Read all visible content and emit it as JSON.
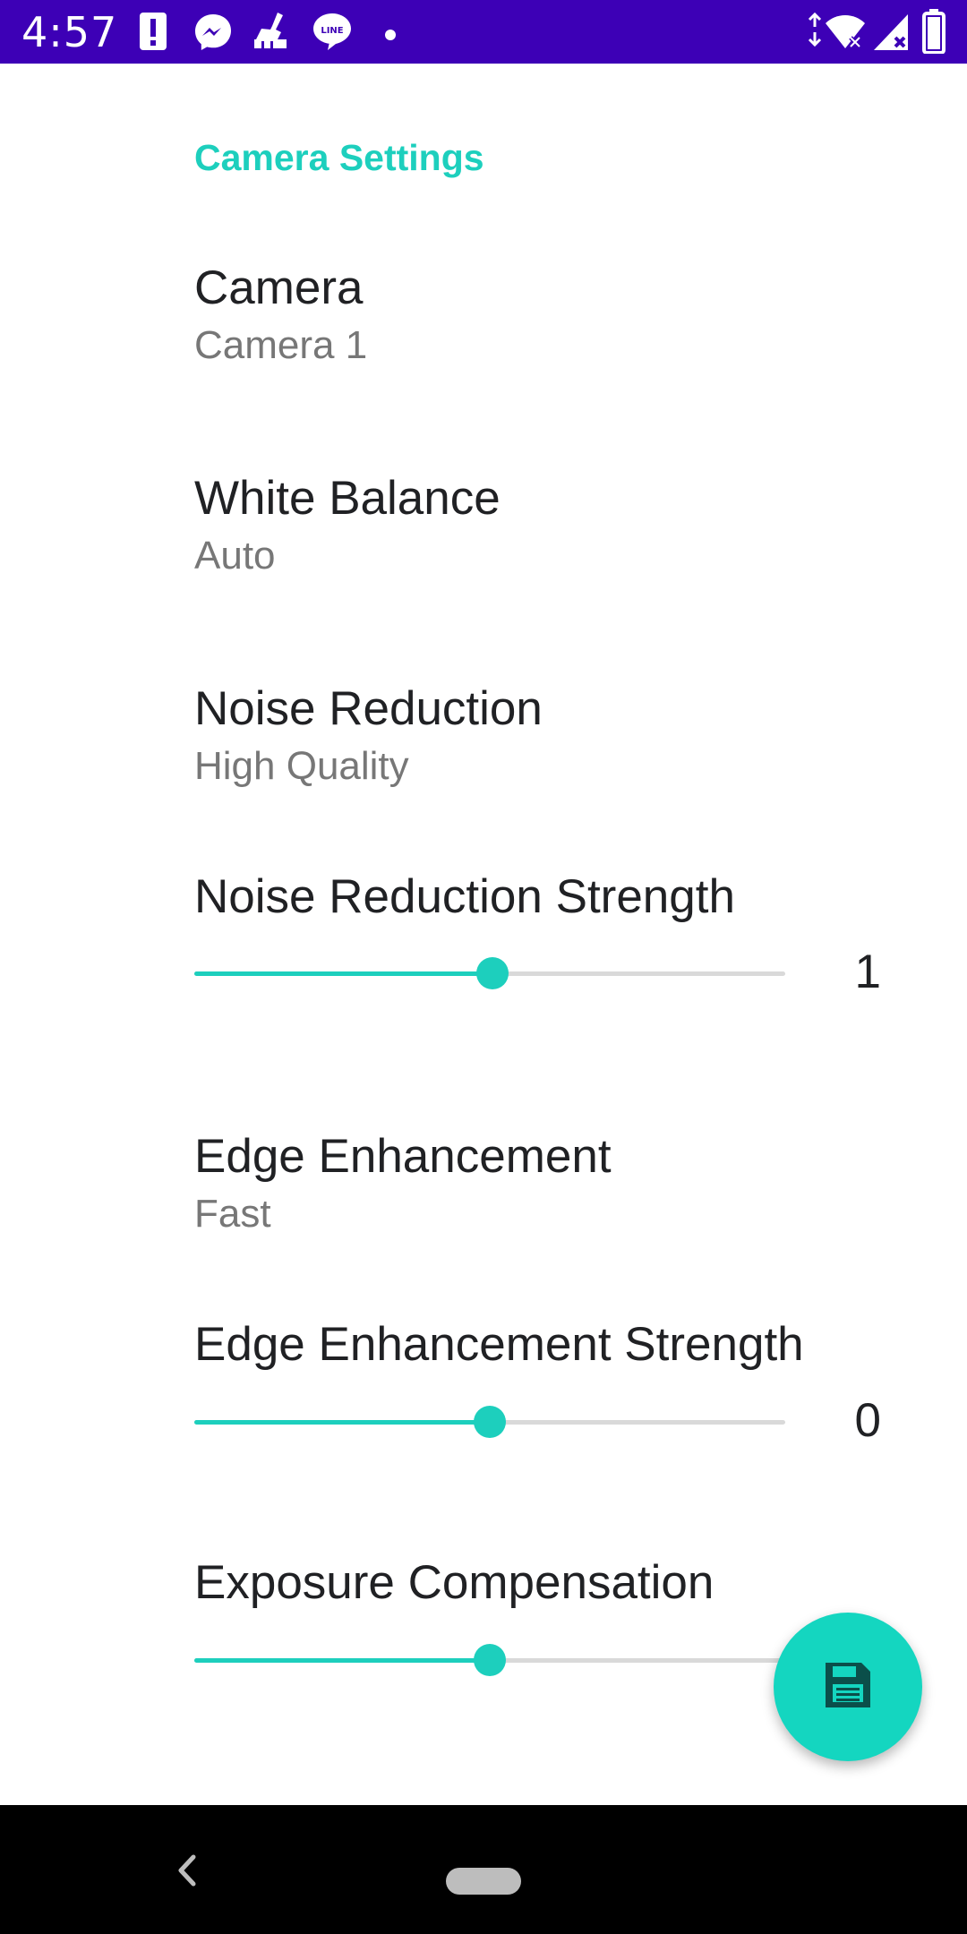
{
  "status_bar": {
    "time": "4:57",
    "background": "#3d00b6",
    "icons": [
      "alert-icon",
      "messenger-icon",
      "cleaner-icon",
      "line-icon",
      "dot-icon",
      "wifi-icon",
      "signal-icon",
      "battery-icon"
    ]
  },
  "settings": {
    "section_title": "Camera Settings",
    "camera": {
      "title": "Camera",
      "summary": "Camera 1"
    },
    "white_balance": {
      "title": "White Balance",
      "summary": "Auto"
    },
    "noise_reduction": {
      "title": "Noise Reduction",
      "summary": "High Quality"
    },
    "noise_reduction_strength": {
      "title": "Noise Reduction Strength",
      "value": "1",
      "fraction": 0.505
    },
    "edge_enhancement": {
      "title": "Edge Enhancement",
      "summary": "Fast"
    },
    "edge_enhancement_strength": {
      "title": "Edge Enhancement Strength",
      "value": "0",
      "fraction": 0.5
    },
    "exposure_compensation": {
      "title": "Exposure Compensation",
      "fraction": 0.5
    }
  },
  "fab": {
    "icon": "save-icon"
  },
  "accent_color": "#1dcfbd"
}
